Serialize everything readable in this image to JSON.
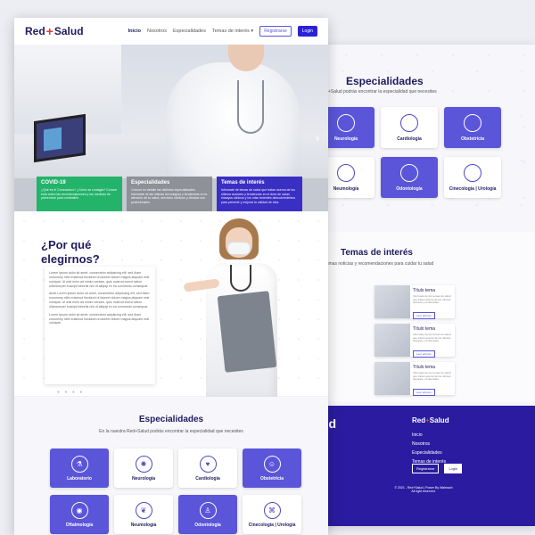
{
  "back_page": {
    "especialidades": {
      "title": "Especialidades",
      "subtitle": "+Salud podrás encontrar la especialidad que necesites",
      "cards": [
        {
          "label": "Neurología",
          "icon": "brain-icon",
          "highlight": true
        },
        {
          "label": "Cardiología",
          "icon": "heart-icon",
          "highlight": false
        },
        {
          "label": "Obstetricia",
          "icon": "baby-icon",
          "highlight": true
        },
        {
          "label": "Neumología",
          "icon": "lungs-icon",
          "highlight": false
        },
        {
          "label": "Odontología",
          "icon": "tooth-icon",
          "highlight": true
        },
        {
          "label": "Cinecología | Urología",
          "icon": "dna-icon",
          "highlight": false
        }
      ]
    },
    "temas": {
      "title": "Temas de interés",
      "subtitle": "timas noticias y recomendaciones para cuidar tu salud",
      "items": [
        {
          "title": "Título tema",
          "desc": "Informate de los temas de salud que tratan acerca de los últimos avances y tendencias",
          "button": "Leer artículo"
        },
        {
          "title": "Título tema",
          "desc": "Informate de los temas de salud que tratan acerca de los últimos avances y tendencias",
          "button": "Leer artículo"
        },
        {
          "title": "Título tema",
          "desc": "Informate de los temas de salud que tratan acerca de los últimos avances y tendencias",
          "button": "Leer artículo"
        }
      ],
      "left_buttons": [
        "Leer artículo",
        "Leer artículo",
        "Leer artículo"
      ]
    },
    "footer": {
      "brand_a": "Red",
      "brand_plus": "+",
      "brand_b": "Salud",
      "menu": [
        "Inicio",
        "Nosotros",
        "Especialidades",
        "Temas de interés"
      ],
      "register": "Registrarse",
      "login": "Login",
      "copyright": "© 2021 - Red+Salud | Power By Walmach",
      "rights": "All right reserved.",
      "big_a": "ud",
      "big_b": "d"
    }
  },
  "nav": {
    "logo_a": "Red",
    "logo_plus": "+",
    "logo_b": "Salud",
    "links": [
      "Inicio",
      "Nosotros",
      "Especialidades",
      "Temas de interés"
    ],
    "register": "Registrarse",
    "login": "Login"
  },
  "hero": {
    "cards": [
      {
        "title": "COVID-19",
        "text": "¿Qué es el Coronavirus? ¿Cómo se contagia? Conoce toda sobre las recomendaciones y las medidas de prevención para combatirlo",
        "color": "#24b36b"
      },
      {
        "title": "Especialidades",
        "text": "Conoce en detalle las distintas especialidades. Infórmate de las últimas tecnologías y tendencias en la atención de tu salud, servicios médicos y clínicas con profesionales.",
        "color": "#8e9198"
      },
      {
        "title": "Temas de interés",
        "text": "Infórmate de temas de salud que tratan acerca de los últimos avances y tendencias en el área de salud, ensayos clínicos y los más recientes descubrimientos para prevenir y mejorar la calidad de vida.",
        "color": "#3a2fc3"
      }
    ]
  },
  "why": {
    "title_line1": "¿Por qué",
    "title_line2": "elegirnos?",
    "paragraphs": [
      "Lorem ipsum dolor sit amet, consectetur adipiscing elit, sed diam nonummy nibh euismod tincidunt ut laoreet dolore magna aliquam erat volutpat. Ut wisi enim ad minim veniam, quis nostrud exerci tation ullamcorper suscipit lobortis nisl ut aliquip ex ea commodo consequat.",
      "Amet Lorem ipsum dolor sit amet, consectetur adipiscing elit, sed diam nonummy nibh euismod tincidunt ut laoreet dolore magna aliquam erat volutpat. Ut wisi enim ad minim veniam, quis nostrud exerci tation ullamcorper suscipit lobortis nisl ut aliquip ex ea commodo consequat.",
      "Lorem ipsum dolor sit amet, consectetur adipiscing elit, sed diam nonummy nibh euismod tincidunt ut laoreet dolore magna aliquam erat volutpat."
    ],
    "dots": "● ● ● ●"
  },
  "especialidades": {
    "title": "Especialidades",
    "subtitle": "En la nuestra Red+Salud podrás encontrar la especialidad que necesites",
    "cards": [
      {
        "label": "Laboratorio",
        "icon": "microscope-icon",
        "glyph": "⚗",
        "highlight": true
      },
      {
        "label": "Neurología",
        "icon": "brain-icon",
        "glyph": "✺",
        "highlight": false
      },
      {
        "label": "Cardiología",
        "icon": "heart-icon",
        "glyph": "♥",
        "highlight": false
      },
      {
        "label": "Obstetricia",
        "icon": "baby-icon",
        "glyph": "☺",
        "highlight": true
      },
      {
        "label": "Oftalmología",
        "icon": "eye-icon",
        "glyph": "◉",
        "highlight": true
      },
      {
        "label": "Neumología",
        "icon": "lungs-icon",
        "glyph": "❦",
        "highlight": false
      },
      {
        "label": "Odontología",
        "icon": "tooth-icon",
        "glyph": "♙",
        "highlight": true
      },
      {
        "label": "Cinecología | Urología",
        "icon": "dna-icon",
        "glyph": "⌘",
        "highlight": false
      }
    ]
  }
}
